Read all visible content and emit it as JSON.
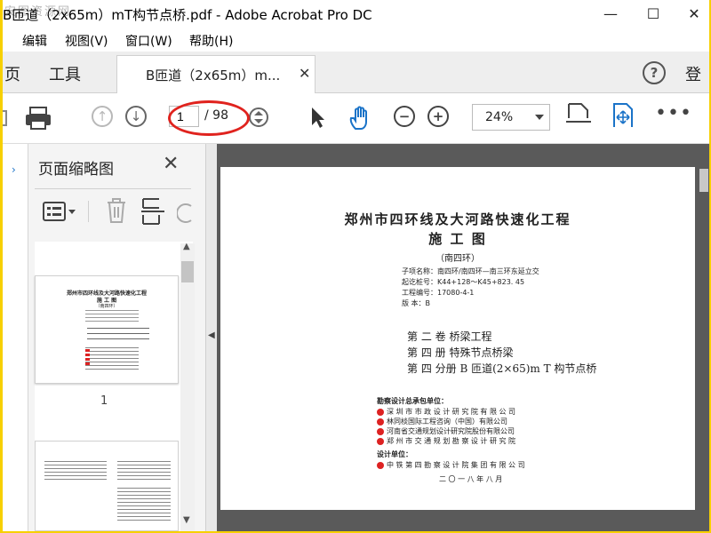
{
  "window": {
    "title": "B匝道（2x65m）mT构节点桥.pdf - Adobe Acrobat Pro DC",
    "watermark": "安图资源网"
  },
  "menu": [
    "编辑",
    "视图(V)",
    "窗口(W)",
    "帮助(H)"
  ],
  "tabs": {
    "home": "页",
    "tools": "工具",
    "document": "B匝道（2x65m）m...",
    "login": "登"
  },
  "toolbar": {
    "current_page": "1",
    "total_pages": "/ 98",
    "zoom": "24%"
  },
  "panel": {
    "title": "页面缩略图",
    "page_label": "1",
    "thumb_title": "郑州市四环线及大河路快速化工程",
    "thumb_sub": "施 工 图",
    "thumb_sub2": "（南四环）"
  },
  "document": {
    "title": "郑州市四环线及大河路快速化工程",
    "subtitle": "施 工 图",
    "section": "（南四环）",
    "meta": [
      "子项名称：南四环/南四环—南三环东延立交",
      "起讫桩号：K44+128～K45+823. 45",
      "工程编号：17080-4-1",
      "版    本：B"
    ],
    "volumes": [
      "第  二  卷   桥梁工程",
      "第    四   册   特殊节点桥梁",
      "第  四  分册   B 匝道(2×65)m T 构节点桥"
    ],
    "contractor_label": "勘察设计总承包单位：",
    "contractors": [
      "深 圳 市 市 政 设 计 研 究 院 有 限 公 司",
      "林同棪国际工程咨询（中国）有限公司",
      "河南省交通规划设计研究院股份有限公司",
      "郑 州 市 交 通 规 划 勘 察 设 计 研 究 院"
    ],
    "design_label": "设计单位：",
    "designer": "中 铁 第 四 勘 察 设 计 院 集 团 有 限 公 司",
    "date": "二 〇 一 八 年 八 月"
  },
  "colors": {
    "accent_blue": "#1a73c8",
    "highlight_red": "#e0231e",
    "frame_yellow": "#f7d000"
  }
}
